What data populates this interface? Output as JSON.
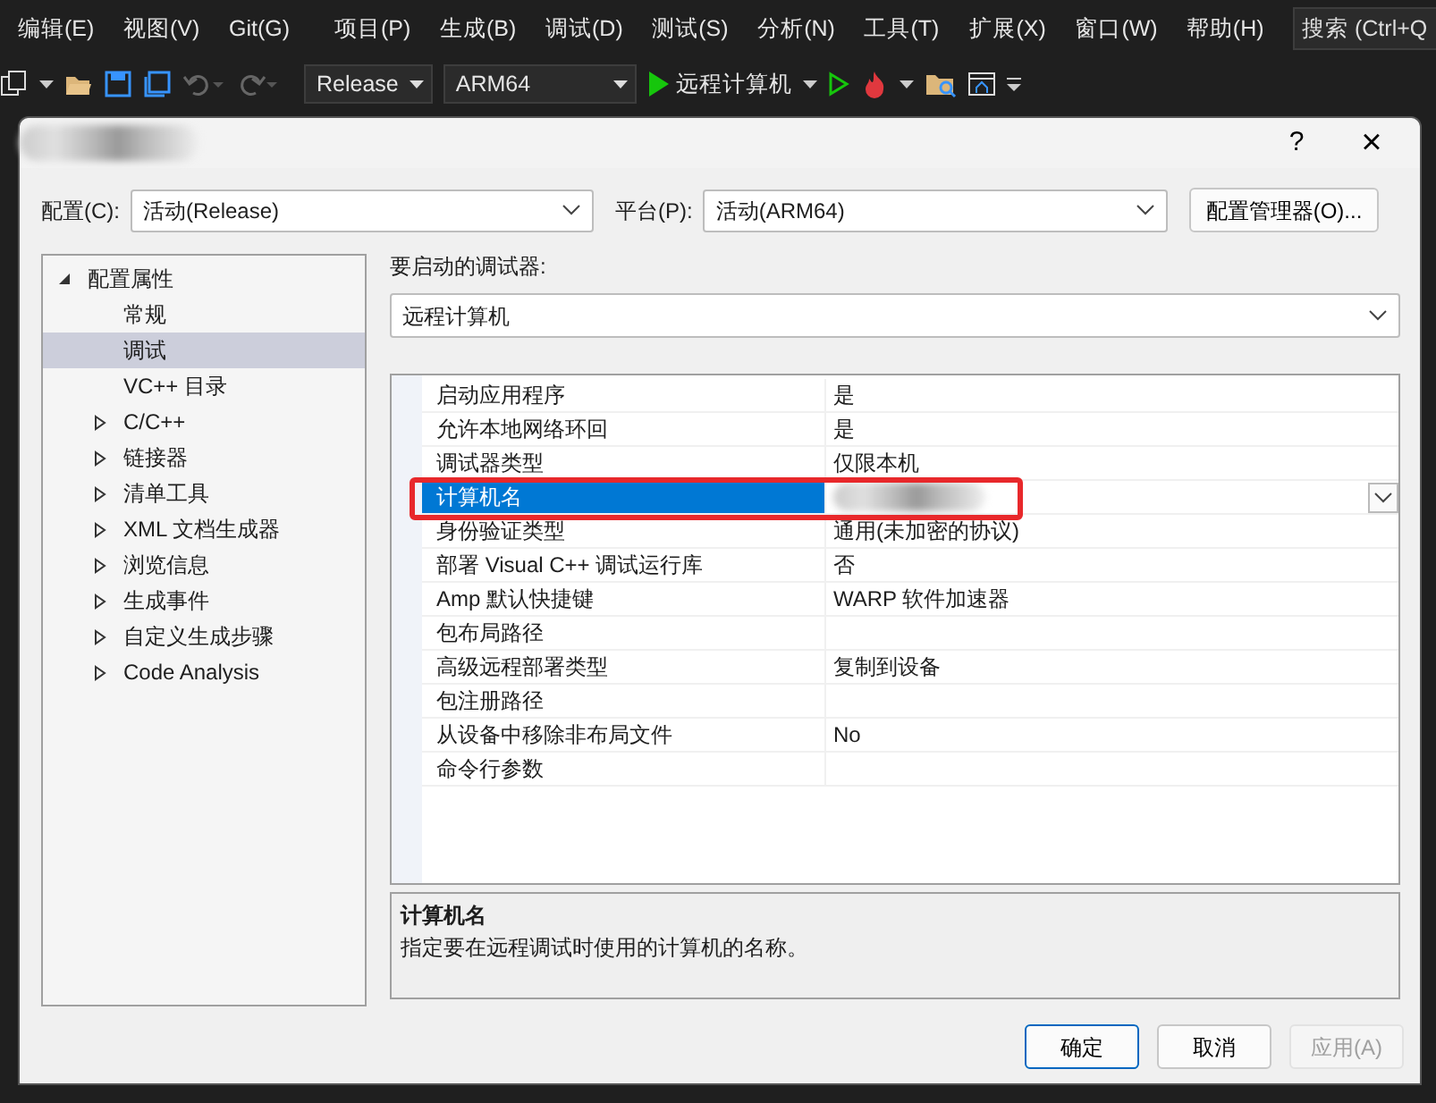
{
  "menu": [
    "编辑(E)",
    "视图(V)",
    "Git(G)",
    "项目(P)",
    "生成(B)",
    "调试(D)",
    "测试(S)",
    "分析(N)",
    "工具(T)",
    "扩展(X)",
    "窗口(W)",
    "帮助(H)"
  ],
  "search": {
    "placeholder": "搜索 (Ctrl+Q"
  },
  "toolbar": {
    "configuration": "Release",
    "platform": "ARM64",
    "run_target": "远程计算机"
  },
  "dialog": {
    "title": {
      "redacted": true
    },
    "help": "?",
    "close": "×",
    "config_label": "配置(C):",
    "config_value": "活动(Release)",
    "platform_label": "平台(P):",
    "platform_value": "活动(ARM64)",
    "manager_button": "配置管理器(O)...",
    "tree": [
      {
        "label": "配置属性",
        "kind": "folder",
        "expanded": true,
        "selected": false,
        "children": [
          {
            "label": "常规",
            "kind": "page",
            "selected": false
          },
          {
            "label": "调试",
            "kind": "page",
            "selected": true
          },
          {
            "label": "VC++ 目录",
            "kind": "page",
            "selected": false
          },
          {
            "label": "C/C++",
            "kind": "folder",
            "expanded": false,
            "selected": false
          },
          {
            "label": "链接器",
            "kind": "folder",
            "expanded": false,
            "selected": false
          },
          {
            "label": "清单工具",
            "kind": "folder",
            "expanded": false,
            "selected": false
          },
          {
            "label": "XML 文档生成器",
            "kind": "folder",
            "expanded": false,
            "selected": false
          },
          {
            "label": "浏览信息",
            "kind": "folder",
            "expanded": false,
            "selected": false
          },
          {
            "label": "生成事件",
            "kind": "folder",
            "expanded": false,
            "selected": false
          },
          {
            "label": "自定义生成步骤",
            "kind": "folder",
            "expanded": false,
            "selected": false
          },
          {
            "label": "Code Analysis",
            "kind": "folder",
            "expanded": false,
            "selected": false
          }
        ]
      }
    ],
    "debugger_label": "要启动的调试器:",
    "debugger_value": "远程计算机",
    "properties": [
      {
        "name": "启动应用程序",
        "value": "是",
        "selected": false
      },
      {
        "name": "允许本地网络环回",
        "value": "是",
        "selected": false
      },
      {
        "name": "调试器类型",
        "value": "仅限本机",
        "selected": false
      },
      {
        "name": "计算机名",
        "redacted": true,
        "selected": true,
        "highlighted": true
      },
      {
        "name": "身份验证类型",
        "value": "通用(未加密的协议)",
        "selected": false
      },
      {
        "name": "部署 Visual C++ 调试运行库",
        "value": "否",
        "selected": false
      },
      {
        "name": "Amp 默认快捷键",
        "value": "WARP 软件加速器",
        "selected": false
      },
      {
        "name": "包布局路径",
        "selected": false
      },
      {
        "name": "高级远程部署类型",
        "value": "复制到设备",
        "selected": false
      },
      {
        "name": "包注册路径",
        "selected": false
      },
      {
        "name": "从设备中移除非布局文件",
        "value": "No",
        "selected": false
      },
      {
        "name": "命令行参数",
        "selected": false
      }
    ],
    "description": {
      "title": "计算机名",
      "text": "指定要在远程调试时使用的计算机的名称。"
    },
    "buttons": [
      {
        "label": "确定",
        "kind": "default",
        "disabled": false
      },
      {
        "label": "取消",
        "kind": "normal",
        "disabled": false
      },
      {
        "label": "应用(A)",
        "kind": "normal",
        "disabled": true
      }
    ]
  }
}
